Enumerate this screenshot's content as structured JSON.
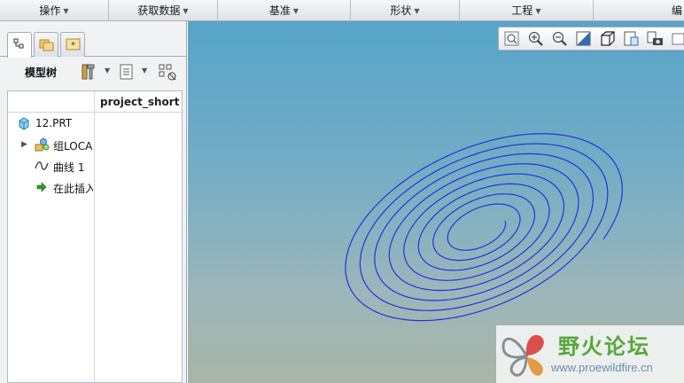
{
  "menubar": {
    "items": [
      {
        "label": "操作"
      },
      {
        "label": "获取数据"
      },
      {
        "label": "基准"
      },
      {
        "label": "形状"
      },
      {
        "label": "工程"
      },
      {
        "label": "编"
      }
    ]
  },
  "left_panel": {
    "tabs": [
      {
        "icon": "model-tree-icon"
      },
      {
        "icon": "folder-browser-icon"
      },
      {
        "icon": "favorites-icon"
      }
    ],
    "toolbar": {
      "title": "模型树",
      "settings_icon": "tools-icon",
      "show_icon": "list-icon",
      "filter_icon": "column-filter-icon"
    },
    "tree": {
      "column_header": "project_short",
      "items": [
        {
          "label": "12.PRT",
          "icon": "part-icon"
        },
        {
          "label": "组LOCA",
          "icon": "group-icon",
          "expandable": true
        },
        {
          "label": "曲线 1",
          "icon": "curve-icon"
        },
        {
          "label": "在此插入",
          "icon": "insert-here-icon"
        }
      ]
    }
  },
  "viewport": {
    "toolbar": [
      {
        "icon": "zoom-fit-icon"
      },
      {
        "icon": "zoom-in-icon"
      },
      {
        "icon": "zoom-out-icon"
      },
      {
        "icon": "repaint-icon"
      },
      {
        "icon": "shaded-cube-icon"
      },
      {
        "icon": "saved-views-icon"
      },
      {
        "icon": "layer-camera-icon"
      },
      {
        "icon": "display-style-icon"
      }
    ],
    "curve_color": "#2233dd",
    "background_top": "#57a5c9",
    "background_bottom": "#a9b5a8"
  },
  "watermark": {
    "title": "野火论坛",
    "url": "www.proewildfire.cn"
  }
}
